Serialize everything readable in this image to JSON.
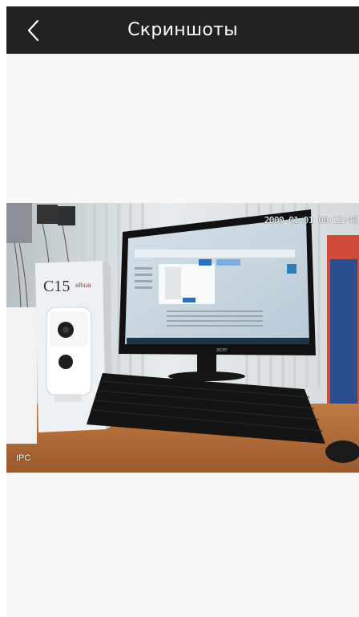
{
  "header": {
    "title": "Скриншоты",
    "back_icon": "chevron-left-icon",
    "background": "#222222"
  },
  "snapshot": {
    "timestamp": "2000-01-01 00:12:46",
    "channel": "IPC",
    "box_model": "C15",
    "box_brand": "alhua",
    "monitor_brand": "acer"
  }
}
